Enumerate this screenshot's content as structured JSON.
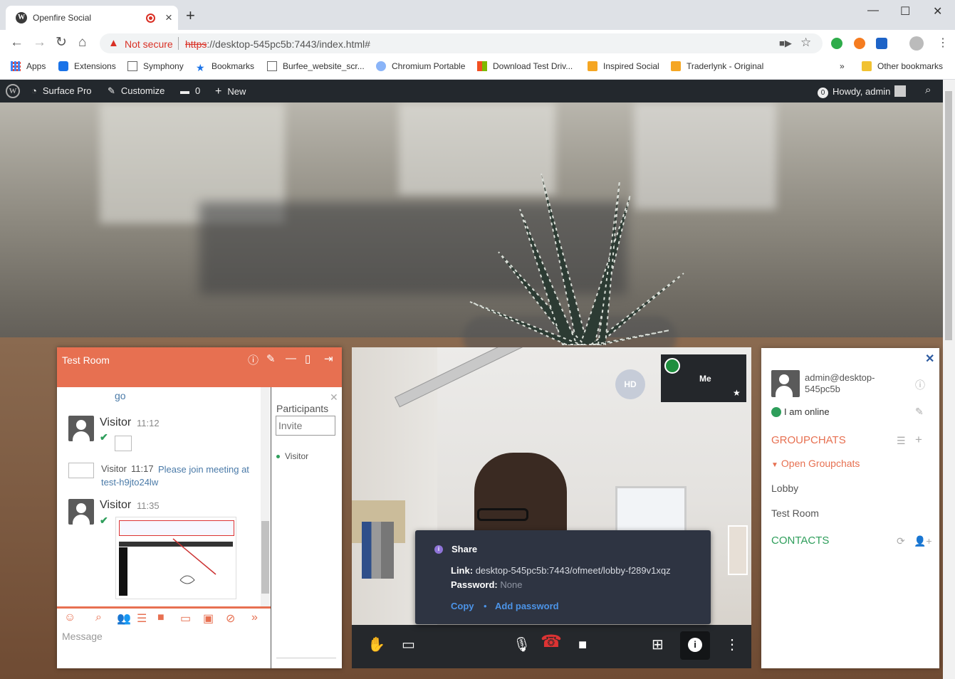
{
  "browser": {
    "tab_title": "Openfire Social",
    "new_tab_label": "+",
    "security_label": "Not secure",
    "url_scheme": "https",
    "url_rest": "://desktop-545pc5b:7443/index.html#",
    "bookmarks": [
      "Apps",
      "Extensions",
      "Symphony",
      "Bookmarks",
      "Burfee_website_scr...",
      "Chromium Portable",
      "Download Test Driv...",
      "Inspired Social",
      "Traderlynk - Original",
      "»",
      "Other bookmarks"
    ]
  },
  "wpbar": {
    "site_name": "Surface Pro",
    "customize_label": "Customize",
    "comments_count": "0",
    "new_label": "New",
    "updates_count": "0",
    "greeting": "Howdy, admin"
  },
  "chat": {
    "room_title": "Test Room",
    "cut_text": "go",
    "messages": [
      {
        "name": "Visitor",
        "time": "11:12"
      },
      {
        "name": "Visitor",
        "time": "11:17",
        "text": "Please join meeting at test-h9jto24lw"
      },
      {
        "name": "Visitor",
        "time": "11:35"
      }
    ],
    "participants_title": "Participants",
    "invite_placeholder": "Invite",
    "participant": "Visitor",
    "composer_placeholder": "Message"
  },
  "video": {
    "hd_badge": "HD",
    "self_label": "Me",
    "share": {
      "title": "Share",
      "link_label": "Link:",
      "link_value": "desktop-545pc5b:7443/ofmeet/lobby-f289v1xqz",
      "password_label": "Password:",
      "password_value": "None",
      "copy_label": "Copy",
      "bullet": "•",
      "add_password_label": "Add password"
    }
  },
  "roster": {
    "jid": "admin@desktop-545pc5b",
    "status": "I am online",
    "groupchats_heading": "GROUPCHATS",
    "open_groupchats": "Open Groupchats",
    "rooms": [
      "Lobby",
      "Test Room"
    ],
    "contacts_heading": "CONTACTS"
  },
  "colors": {
    "accent_orange": "#e77051",
    "online_green": "#2e9e5b",
    "link_blue": "#4c94e8"
  }
}
